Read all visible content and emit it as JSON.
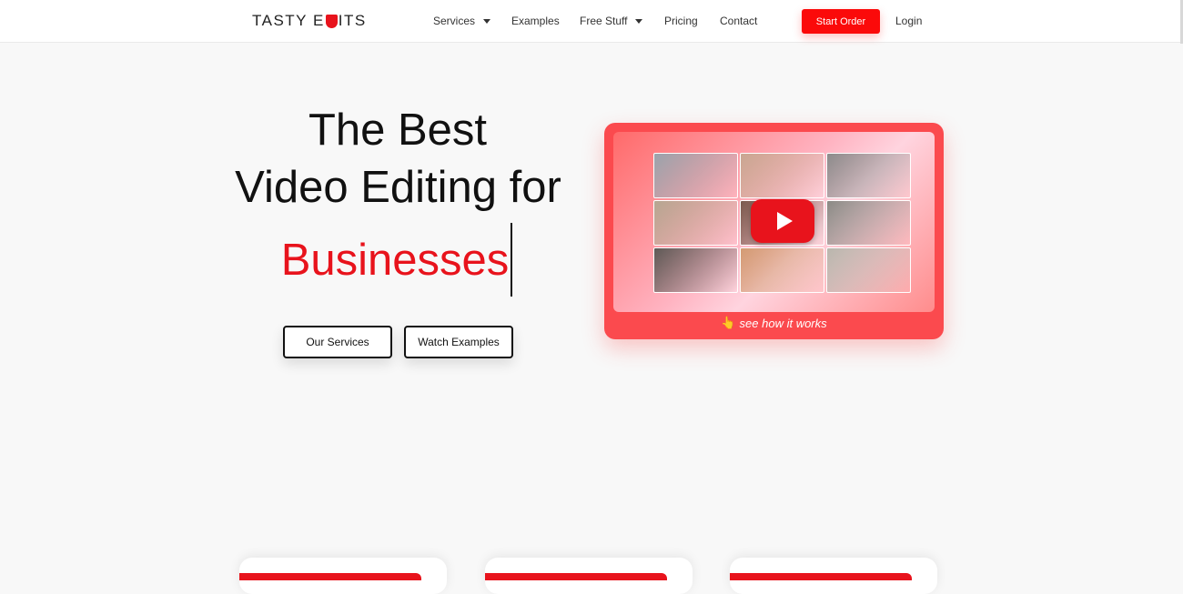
{
  "brand": {
    "name_left": "TASTY E",
    "name_right": "ITS",
    "accent_color": "#e8131c"
  },
  "nav": {
    "items": [
      {
        "label": "Services",
        "dropdown": true
      },
      {
        "label": "Examples",
        "dropdown": false
      },
      {
        "label": "Free Stuff",
        "dropdown": true
      },
      {
        "label": "Pricing",
        "dropdown": false
      },
      {
        "label": "Contact",
        "dropdown": false
      }
    ],
    "cta_label": "Start Order",
    "login_label": "Login"
  },
  "hero": {
    "line1": "The Best",
    "line2": "Video Editing for",
    "accent_word": "Businesses",
    "buttons": {
      "services": "Our Services",
      "examples": "Watch Examples"
    }
  },
  "video_card": {
    "caption": "see how it works",
    "caption_icon": "pointing-hand-icon",
    "play_icon": "play-icon",
    "thumbnail_colors": [
      "#9aa4ad",
      "#c9a792",
      "#8c8c8c",
      "#b6a792",
      "#7a5a4e",
      "#8b8a85",
      "#5e5a57",
      "#d39b73",
      "#b9b6ad"
    ]
  },
  "colors": {
    "background": "#f8f8f8",
    "cta": "#fb0a0a",
    "card": "#fb4a4e"
  }
}
